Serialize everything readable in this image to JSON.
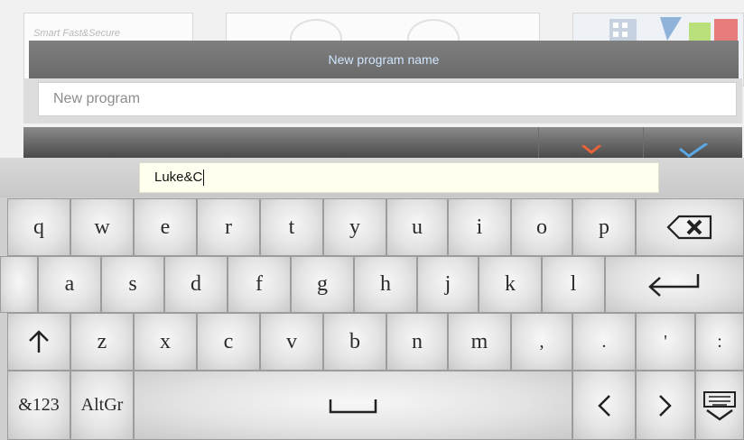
{
  "background": {
    "logo_text": "Smart Fast&Secure"
  },
  "dialog": {
    "title": "New program name",
    "input_placeholder": "New program",
    "cancel_icon": "close-icon",
    "confirm_icon": "check-icon",
    "accent_cancel": "#e8623a",
    "accent_confirm": "#5aa8e6"
  },
  "keyboard": {
    "text_field_value": "Luke&C",
    "row1": [
      "q",
      "w",
      "e",
      "r",
      "t",
      "y",
      "u",
      "i",
      "o",
      "p"
    ],
    "row2": [
      "a",
      "s",
      "d",
      "f",
      "g",
      "h",
      "j",
      "k",
      "l"
    ],
    "row3": [
      "z",
      "x",
      "c",
      "v",
      "b",
      "n",
      "m",
      ",",
      ".",
      "'",
      ":"
    ],
    "numbers_key": "&123",
    "altgr_key": "AltGr",
    "icons": {
      "backspace": "backspace-icon",
      "enter": "enter-icon",
      "shift": "shift-arrow-icon",
      "space": "space-bar-icon",
      "left": "arrow-left-icon",
      "right": "arrow-right-icon",
      "hide": "keyboard-hide-icon"
    }
  }
}
